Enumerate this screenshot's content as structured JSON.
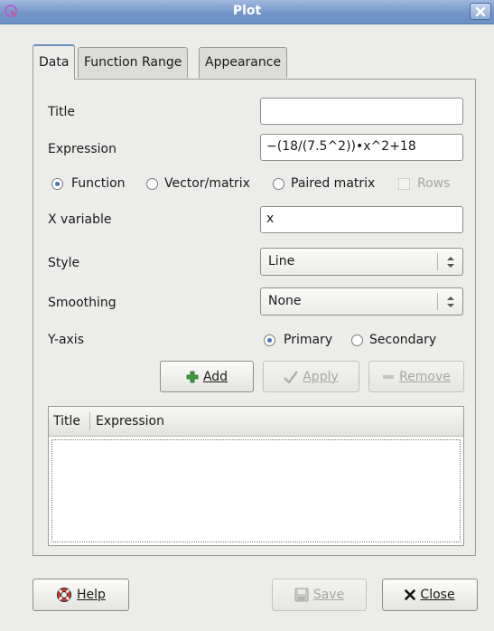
{
  "window": {
    "title": "Plot",
    "accent": "#6c8fc2"
  },
  "tabs": [
    {
      "label": "Data",
      "active": true
    },
    {
      "label": "Function Range",
      "active": false
    },
    {
      "label": "Appearance",
      "active": false
    }
  ],
  "form": {
    "title_label": "Title",
    "title_value": "",
    "expression_label": "Expression",
    "expression_value": "−(18/(7.5^2))•x^2+18",
    "type_options": [
      {
        "label": "Function",
        "selected": true
      },
      {
        "label": "Vector/matrix",
        "selected": false
      },
      {
        "label": "Paired matrix",
        "selected": false
      }
    ],
    "rows_label": "Rows",
    "rows_checked": false,
    "x_variable_label": "X variable",
    "x_variable_value": "x",
    "style_label": "Style",
    "style_value": "Line",
    "smoothing_label": "Smoothing",
    "smoothing_value": "None",
    "yaxis_label": "Y-axis",
    "yaxis_options": [
      {
        "label": "Primary",
        "selected": true
      },
      {
        "label": "Secondary",
        "selected": false
      }
    ]
  },
  "actions": {
    "add": {
      "label": "Add",
      "icon": "plus-icon"
    },
    "apply": {
      "label": "Apply",
      "icon": "checkmark-icon",
      "enabled": false
    },
    "remove": {
      "label": "Remove",
      "icon": "minus-icon",
      "enabled": false
    }
  },
  "list": {
    "columns": [
      "Title",
      "Expression"
    ],
    "rows": []
  },
  "footer": {
    "help": {
      "label": "Help",
      "icon": "lifebuoy-icon"
    },
    "save": {
      "label": "Save",
      "icon": "floppy-disk-icon",
      "enabled": false
    },
    "close": {
      "label": "Close",
      "icon": "x-icon"
    }
  }
}
